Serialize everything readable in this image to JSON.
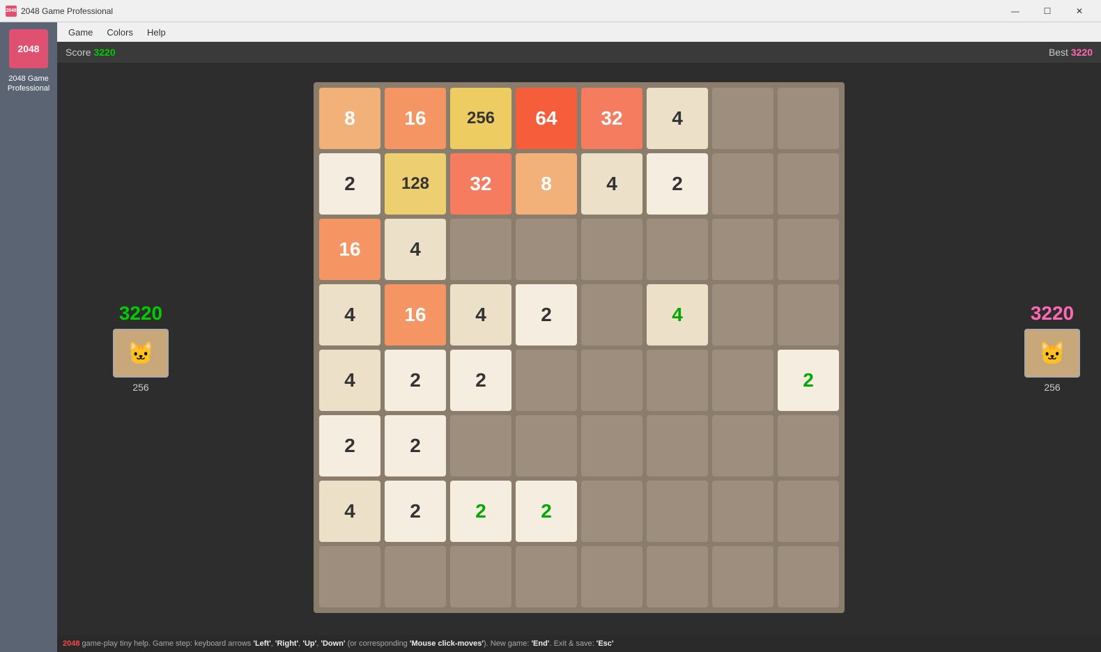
{
  "titlebar": {
    "icon_text": "2048",
    "title": "2048 Game Professional",
    "minimize": "—",
    "maximize": "☐",
    "close": "✕"
  },
  "sidebar": {
    "logo": "2048",
    "app_name": "2048 Game\nProfessional"
  },
  "menu": {
    "items": [
      "Game",
      "Colors",
      "Help"
    ]
  },
  "scorebar": {
    "score_label": "Score ",
    "score_value": "3220",
    "best_label": "Best ",
    "best_value": "3220"
  },
  "left_panel": {
    "score": "3220",
    "cat_emoji": "🐱",
    "tile_value": "256"
  },
  "right_panel": {
    "score": "3220",
    "cat_emoji": "🐱",
    "tile_value": "256"
  },
  "grid": {
    "rows": [
      [
        {
          "val": 8,
          "cls": "cell-8"
        },
        {
          "val": 16,
          "cls": "cell-16"
        },
        {
          "val": 256,
          "cls": "cell-256"
        },
        {
          "val": 64,
          "cls": "cell-64"
        },
        {
          "val": 32,
          "cls": "cell-32"
        },
        {
          "val": 4,
          "cls": "cell-4"
        },
        {
          "val": "",
          "cls": "cell-empty"
        },
        {
          "val": "",
          "cls": "cell-empty"
        }
      ],
      [
        {
          "val": 2,
          "cls": "cell-2"
        },
        {
          "val": 128,
          "cls": "cell-128"
        },
        {
          "val": 32,
          "cls": "cell-32"
        },
        {
          "val": 8,
          "cls": "cell-8"
        },
        {
          "val": 4,
          "cls": "cell-4"
        },
        {
          "val": 2,
          "cls": "cell-2"
        },
        {
          "val": "",
          "cls": "cell-empty"
        },
        {
          "val": "",
          "cls": "cell-empty"
        }
      ],
      [
        {
          "val": 16,
          "cls": "cell-16"
        },
        {
          "val": 4,
          "cls": "cell-4"
        },
        {
          "val": "",
          "cls": "cell-empty"
        },
        {
          "val": "",
          "cls": "cell-empty"
        },
        {
          "val": "",
          "cls": "cell-empty"
        },
        {
          "val": "",
          "cls": "cell-empty"
        },
        {
          "val": "",
          "cls": "cell-empty"
        },
        {
          "val": "",
          "cls": "cell-empty"
        }
      ],
      [
        {
          "val": 4,
          "cls": "cell-4"
        },
        {
          "val": 16,
          "cls": "cell-16"
        },
        {
          "val": 4,
          "cls": "cell-4"
        },
        {
          "val": 2,
          "cls": "cell-2"
        },
        {
          "val": "",
          "cls": "cell-empty"
        },
        {
          "val": 4,
          "cls": "cell-4-green",
          "special": "green"
        },
        {
          "val": "",
          "cls": "cell-empty"
        },
        {
          "val": "",
          "cls": "cell-empty"
        }
      ],
      [
        {
          "val": 4,
          "cls": "cell-4"
        },
        {
          "val": 2,
          "cls": "cell-2"
        },
        {
          "val": 2,
          "cls": "cell-2"
        },
        {
          "val": "",
          "cls": "cell-empty"
        },
        {
          "val": "",
          "cls": "cell-empty"
        },
        {
          "val": "",
          "cls": "cell-empty"
        },
        {
          "val": "",
          "cls": "cell-empty"
        },
        {
          "val": 2,
          "cls": "cell-2-green",
          "special": "green"
        }
      ],
      [
        {
          "val": 2,
          "cls": "cell-2"
        },
        {
          "val": 2,
          "cls": "cell-2"
        },
        {
          "val": "",
          "cls": "cell-empty"
        },
        {
          "val": "",
          "cls": "cell-empty"
        },
        {
          "val": "",
          "cls": "cell-empty"
        },
        {
          "val": "",
          "cls": "cell-empty"
        },
        {
          "val": "",
          "cls": "cell-empty"
        },
        {
          "val": "",
          "cls": "cell-empty"
        }
      ],
      [
        {
          "val": 4,
          "cls": "cell-4"
        },
        {
          "val": 2,
          "cls": "cell-2"
        },
        {
          "val": 2,
          "cls": "cell-2-green",
          "special": "green"
        },
        {
          "val": 2,
          "cls": "cell-2-green",
          "special": "green"
        },
        {
          "val": "",
          "cls": "cell-empty"
        },
        {
          "val": "",
          "cls": "cell-empty"
        },
        {
          "val": "",
          "cls": "cell-empty"
        },
        {
          "val": "",
          "cls": "cell-empty"
        }
      ],
      [
        {
          "val": "",
          "cls": "cell-empty"
        },
        {
          "val": "",
          "cls": "cell-empty"
        },
        {
          "val": "",
          "cls": "cell-empty"
        },
        {
          "val": "",
          "cls": "cell-empty"
        },
        {
          "val": "",
          "cls": "cell-empty"
        },
        {
          "val": "",
          "cls": "cell-empty"
        },
        {
          "val": "",
          "cls": "cell-empty"
        },
        {
          "val": "",
          "cls": "cell-empty"
        }
      ]
    ]
  },
  "statusbar": {
    "text": " game-play tiny help. Game step: keyboard arrows 'Left', 'Right', 'Up', 'Down' (or corresponding 'Mouse click-moves'). New game: 'End'. Exit & save: 'Esc'"
  }
}
